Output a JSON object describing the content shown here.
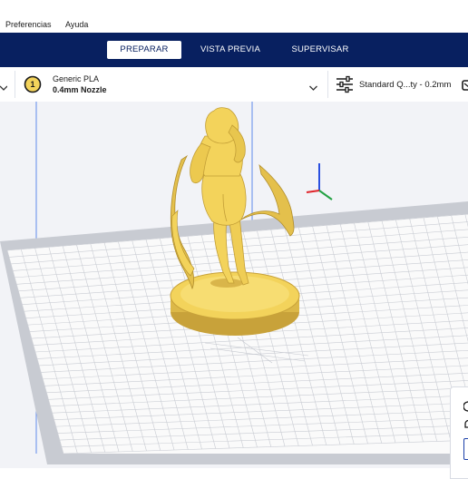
{
  "menu": {
    "items": [
      {
        "label": "Preferencias"
      },
      {
        "label": "Ayuda"
      }
    ]
  },
  "stages": {
    "prepare": "PREPARAR",
    "preview": "VISTA PREVIA",
    "monitor": "SUPERVISAR",
    "active": "prepare"
  },
  "material": {
    "extruder_number": "1",
    "name": "Generic PLA",
    "nozzle": "0.4mm Nozzle"
  },
  "print_settings": {
    "profile": "Standard Q...ty - 0.2mm"
  },
  "colors": {
    "stage_bar": "#082060",
    "model": "#f3d35b",
    "build_plate": "#fafafa",
    "grid_line": "#c9ccd3",
    "axis_x": "#e0252b",
    "axis_y": "#2a4fe0",
    "axis_z": "#25a244",
    "viewport_background": "#f2f3f7"
  },
  "icons": {
    "material_dropdown": "chevron-down-icon",
    "left_dropdown": "chevron-down-icon",
    "settings": "sliders-icon"
  }
}
